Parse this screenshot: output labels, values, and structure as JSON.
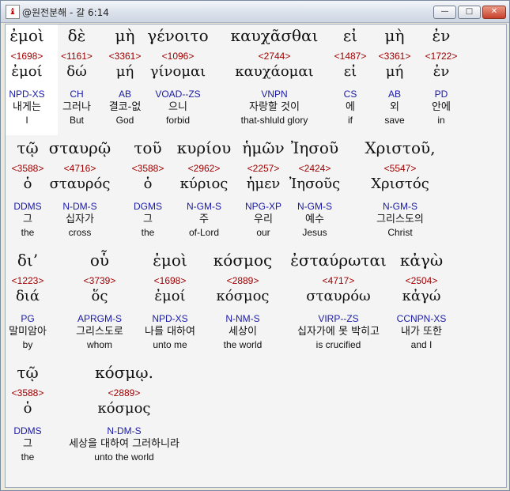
{
  "window": {
    "title": "@원전분해 - 갈 6:14",
    "app_icon_glyph": "♝",
    "min_glyph": "—",
    "max_glyph": "□",
    "close_glyph": "✕"
  },
  "words": [
    {
      "greek": "ἐμοὶ",
      "strong": "<1698>",
      "lemma": "ἐμοί",
      "parse": "NPD-XS",
      "korean": "내게는",
      "english": "I"
    },
    {
      "greek": "δὲ",
      "strong": "<1161>",
      "lemma": "δώ",
      "parse": "CH",
      "korean": "그러나",
      "english": "But"
    },
    {
      "greek": "μὴ",
      "strong": "<3361>",
      "lemma": "μή",
      "parse": "AB",
      "korean": "결코-없",
      "english": "God"
    },
    {
      "greek": "γένοιτο",
      "strong": "<1096>",
      "lemma": "γίνομαι",
      "parse": "VOAD--ZS",
      "korean": "으니",
      "english": "forbid"
    },
    {
      "greek": "καυχᾶσθαι",
      "strong": "<2744>",
      "lemma": "καυχάομαι",
      "parse": "VNPN",
      "korean": "자랑할 것이",
      "english": "that-shluld glory"
    },
    {
      "greek": "εἰ",
      "strong": "<1487>",
      "lemma": "εἰ",
      "parse": "CS",
      "korean": "에",
      "english": "if"
    },
    {
      "greek": "μὴ",
      "strong": "<3361>",
      "lemma": "μή",
      "parse": "AB",
      "korean": "외",
      "english": "save"
    },
    {
      "greek": "ἐν",
      "strong": "<1722>",
      "lemma": "ἐν",
      "parse": "PD",
      "korean": "안에",
      "english": "in"
    },
    {
      "greek": "τῷ",
      "strong": "<3588>",
      "lemma": "ὁ",
      "parse": "DDMS",
      "korean": "그",
      "english": "the"
    },
    {
      "greek": "σταυρῷ",
      "strong": "<4716>",
      "lemma": "σταυρός",
      "parse": "N-DM-S",
      "korean": "십자가",
      "english": "cross"
    },
    {
      "greek": "τοῦ",
      "strong": "<3588>",
      "lemma": "ὁ",
      "parse": "DGMS",
      "korean": "그",
      "english": "the"
    },
    {
      "greek": "κυρίου",
      "strong": "<2962>",
      "lemma": "κύριος",
      "parse": "N-GM-S",
      "korean": "주",
      "english": "of-Lord"
    },
    {
      "greek": "ἡμῶν",
      "strong": "<2257>",
      "lemma": "ἡμεν",
      "parse": "NPG-XP",
      "korean": "우리",
      "english": "our"
    },
    {
      "greek": "Ἰησοῦ",
      "strong": "<2424>",
      "lemma": "Ἰησοῦς",
      "parse": "N-GM-S",
      "korean": "예수",
      "english": "Jesus"
    },
    {
      "greek": "Χριστοῦ,",
      "strong": "<5547>",
      "lemma": "Χριστός",
      "parse": "N-GM-S",
      "korean": "그리스도의",
      "english": "Christ"
    },
    {
      "greek": "δι’",
      "strong": "<1223>",
      "lemma": "διά",
      "parse": "PG",
      "korean": "말미암아",
      "english": "by"
    },
    {
      "greek": "οὗ",
      "strong": "<3739>",
      "lemma": "ὅς",
      "parse": "APRGM-S",
      "korean": "그리스도로",
      "english": "whom"
    },
    {
      "greek": "ἐμοὶ",
      "strong": "<1698>",
      "lemma": "ἐμοί",
      "parse": "NPD-XS",
      "korean": "나를 대하여",
      "english": "unto me"
    },
    {
      "greek": "κόσμος",
      "strong": "<2889>",
      "lemma": "κόσμος",
      "parse": "N-NM-S",
      "korean": "세상이",
      "english": "the world"
    },
    {
      "greek": "ἐσταύρωται",
      "strong": "<4717>",
      "lemma": "σταυρόω",
      "parse": "VIRP--ZS",
      "korean": "십자가에 못 박히고",
      "english": "is crucified"
    },
    {
      "greek": "κἀγὼ",
      "strong": "<2504>",
      "lemma": "κἀγώ",
      "parse": "CCNPN-XS",
      "korean": "내가 또한",
      "english": "and I"
    },
    {
      "greek": "τῷ",
      "strong": "<3588>",
      "lemma": "ὁ",
      "parse": "DDMS",
      "korean": "그",
      "english": "the"
    },
    {
      "greek": "κόσμῳ.",
      "strong": "<2889>",
      "lemma": "κόσμος",
      "parse": "N-DM-S",
      "korean": "세상을 대하여 그러하니라",
      "english": "unto the world"
    }
  ]
}
